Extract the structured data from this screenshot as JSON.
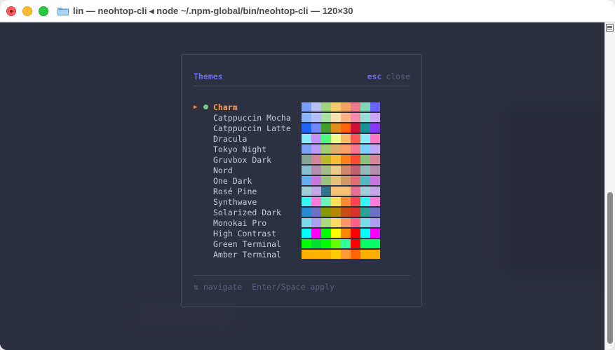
{
  "window": {
    "title": "lin — neohtop-cli ◂ node ~/.npm-global/bin/neohtop-cli — 120×30",
    "folder_icon": "folder-icon"
  },
  "dialog": {
    "title": "Themes",
    "esc_label": "esc",
    "close_label": "close",
    "footer": {
      "navigate": "⇅ navigate",
      "apply": "Enter/Space apply"
    },
    "themes": [
      {
        "name": "Charm",
        "selected": true,
        "active": true,
        "colors": [
          "#7b9dff",
          "#b8c0f5",
          "#9fd37b",
          "#f4c96a",
          "#f5a25d",
          "#f07a8c",
          "#7fd6b3",
          "#6c63ff"
        ]
      },
      {
        "name": "Catppuccin Mocha",
        "selected": false,
        "active": false,
        "colors": [
          "#89b4fa",
          "#b4befe",
          "#a6e3a1",
          "#f9e2af",
          "#fab387",
          "#f38ba8",
          "#94e2d5",
          "#cba6f7"
        ]
      },
      {
        "name": "Catppuccin Latte",
        "selected": false,
        "active": false,
        "colors": [
          "#1e66f5",
          "#7287fd",
          "#40a02b",
          "#df8e1d",
          "#fe640b",
          "#d20f39",
          "#179299",
          "#8839ef"
        ]
      },
      {
        "name": "Dracula",
        "selected": false,
        "active": false,
        "colors": [
          "#8be9fd",
          "#bd93f9",
          "#50fa7b",
          "#f1fa8c",
          "#ffb86c",
          "#ff5555",
          "#8be9fd",
          "#ff79c6"
        ]
      },
      {
        "name": "Tokyo Night",
        "selected": false,
        "active": false,
        "colors": [
          "#7aa2f7",
          "#bb9af7",
          "#9ece6a",
          "#e0af68",
          "#ff9e64",
          "#f7768e",
          "#7dcfff",
          "#c0a8f7"
        ]
      },
      {
        "name": "Gruvbox Dark",
        "selected": false,
        "active": false,
        "colors": [
          "#83a598",
          "#d3869b",
          "#b8bb26",
          "#fabd2f",
          "#fe8019",
          "#fb4934",
          "#8ec07c",
          "#d3869b"
        ]
      },
      {
        "name": "Nord",
        "selected": false,
        "active": false,
        "colors": [
          "#88c0d0",
          "#b48ead",
          "#a3be8c",
          "#ebcb8b",
          "#d08770",
          "#bf616a",
          "#8fbcbb",
          "#b48ead"
        ]
      },
      {
        "name": "One Dark",
        "selected": false,
        "active": false,
        "colors": [
          "#61afef",
          "#c678dd",
          "#98c379",
          "#e5c07b",
          "#d19a66",
          "#e06c75",
          "#56b6c2",
          "#c678dd"
        ]
      },
      {
        "name": "Rosé Pine",
        "selected": false,
        "active": false,
        "colors": [
          "#9ccfd8",
          "#c4a7e7",
          "#31748f",
          "#f6c177",
          "#f6c177",
          "#eb6f92",
          "#9ccfd8",
          "#c4a7e7"
        ]
      },
      {
        "name": "Synthwave",
        "selected": false,
        "active": false,
        "colors": [
          "#36f9f6",
          "#ff7edb",
          "#72f1b8",
          "#fede5d",
          "#ff8b39",
          "#fe4450",
          "#36f9f6",
          "#ff7edb"
        ]
      },
      {
        "name": "Solarized Dark",
        "selected": false,
        "active": false,
        "colors": [
          "#268bd2",
          "#6c71c4",
          "#859900",
          "#b58900",
          "#cb4b16",
          "#dc322f",
          "#2aa198",
          "#6c71c4"
        ]
      },
      {
        "name": "Monokai Pro",
        "selected": false,
        "active": false,
        "colors": [
          "#78dce8",
          "#ab9df2",
          "#a9dc76",
          "#ffd866",
          "#fc9867",
          "#ff6188",
          "#78dce8",
          "#ab9df2"
        ]
      },
      {
        "name": "High Contrast",
        "selected": false,
        "active": false,
        "colors": [
          "#00ffff",
          "#ff00ff",
          "#00ff00",
          "#ffff00",
          "#ff8800",
          "#ff0000",
          "#00ffff",
          "#ff00ff"
        ]
      },
      {
        "name": "Green Terminal",
        "selected": false,
        "active": false,
        "colors": [
          "#00ff00",
          "#00dd33",
          "#00ff00",
          "#66ff00",
          "#33ff99",
          "#ff0000",
          "#00ff66",
          "#00ff66"
        ]
      },
      {
        "name": "Amber Terminal",
        "selected": false,
        "active": false,
        "colors": [
          "#ffb000",
          "#ffb000",
          "#ffb000",
          "#ffcc00",
          "#ff9933",
          "#ff6600",
          "#ffb000",
          "#ffb000"
        ]
      }
    ]
  },
  "colors": {
    "accent": "#6b6bff",
    "active_theme": "#ff9a4a",
    "current_dot": "#73c97a",
    "background": "#2c2f3d"
  }
}
